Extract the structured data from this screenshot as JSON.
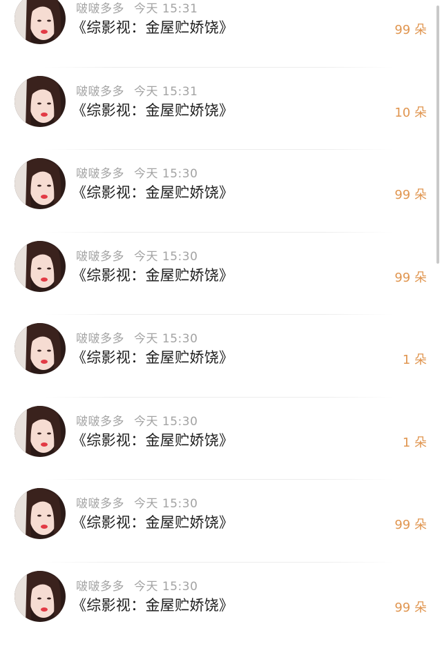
{
  "items": [
    {
      "user": "啵啵多多",
      "time": "今天 15:31",
      "title": "《综影视：金屋贮娇饶》",
      "gift": "99 朵"
    },
    {
      "user": "啵啵多多",
      "time": "今天 15:31",
      "title": "《综影视：金屋贮娇饶》",
      "gift": "10 朵"
    },
    {
      "user": "啵啵多多",
      "time": "今天 15:30",
      "title": "《综影视：金屋贮娇饶》",
      "gift": "99 朵"
    },
    {
      "user": "啵啵多多",
      "time": "今天 15:30",
      "title": "《综影视：金屋贮娇饶》",
      "gift": "99 朵"
    },
    {
      "user": "啵啵多多",
      "time": "今天 15:30",
      "title": "《综影视：金屋贮娇饶》",
      "gift": "1 朵"
    },
    {
      "user": "啵啵多多",
      "time": "今天 15:30",
      "title": "《综影视：金屋贮娇饶》",
      "gift": "1 朵"
    },
    {
      "user": "啵啵多多",
      "time": "今天 15:30",
      "title": "《综影视：金屋贮娇饶》",
      "gift": "99 朵"
    },
    {
      "user": "啵啵多多",
      "time": "今天 15:30",
      "title": "《综影视：金屋贮娇饶》",
      "gift": "99 朵"
    }
  ],
  "colors": {
    "gift": "#e0954f",
    "meta": "#a3a3a3",
    "title": "#1e1e1e"
  }
}
